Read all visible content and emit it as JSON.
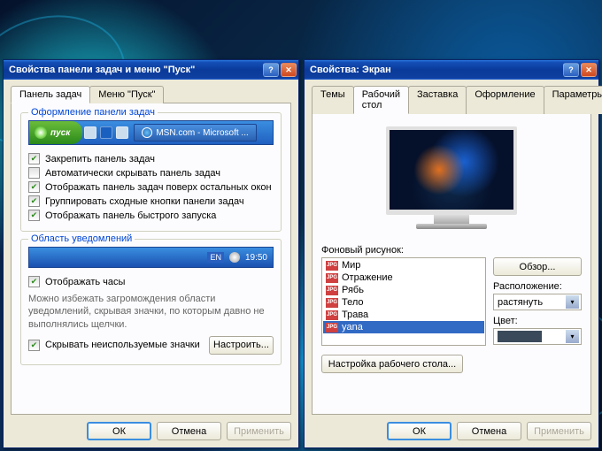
{
  "left_window": {
    "title": "Свойства панели задач и меню \"Пуск\"",
    "tabs": [
      "Панель задач",
      "Меню \"Пуск\""
    ],
    "active_tab": 0,
    "group1_title": "Оформление панели задач",
    "start_label": "пуск",
    "task_item_label": "MSN.com - Microsoft ...",
    "checkboxes": [
      {
        "label": "Закрепить панель задач",
        "checked": true
      },
      {
        "label": "Автоматически скрывать панель задач",
        "checked": false
      },
      {
        "label": "Отображать панель задач поверх остальных окон",
        "checked": true
      },
      {
        "label": "Группировать сходные кнопки панели задач",
        "checked": true
      },
      {
        "label": "Отображать панель быстрого запуска",
        "checked": true
      }
    ],
    "group2_title": "Область уведомлений",
    "lang": "EN",
    "time": "19:50",
    "show_clock": {
      "label": "Отображать часы",
      "checked": true
    },
    "note": "Можно избежать загромождения области уведомлений, скрывая значки, по которым давно не выполнялись щелчки.",
    "hide_unused": {
      "label": "Скрывать неиспользуемые значки",
      "checked": true
    },
    "configure_btn": "Настроить..."
  },
  "right_window": {
    "title": "Свойства: Экран",
    "tabs": [
      "Темы",
      "Рабочий стол",
      "Заставка",
      "Оформление",
      "Параметры"
    ],
    "active_tab": 1,
    "bg_label": "Фоновый рисунок:",
    "bg_items": [
      "Мир",
      "Отражение",
      "Рябь",
      "Тело",
      "Трава",
      "yana"
    ],
    "bg_selected": 5,
    "browse_btn": "Обзор...",
    "position_label": "Расположение:",
    "position_value": "растянуть",
    "color_label": "Цвет:",
    "color_value": "#3a4a5a",
    "desktop_settings_btn": "Настройка рабочего стола..."
  },
  "common": {
    "ok": "ОК",
    "cancel": "Отмена",
    "apply": "Применить"
  }
}
